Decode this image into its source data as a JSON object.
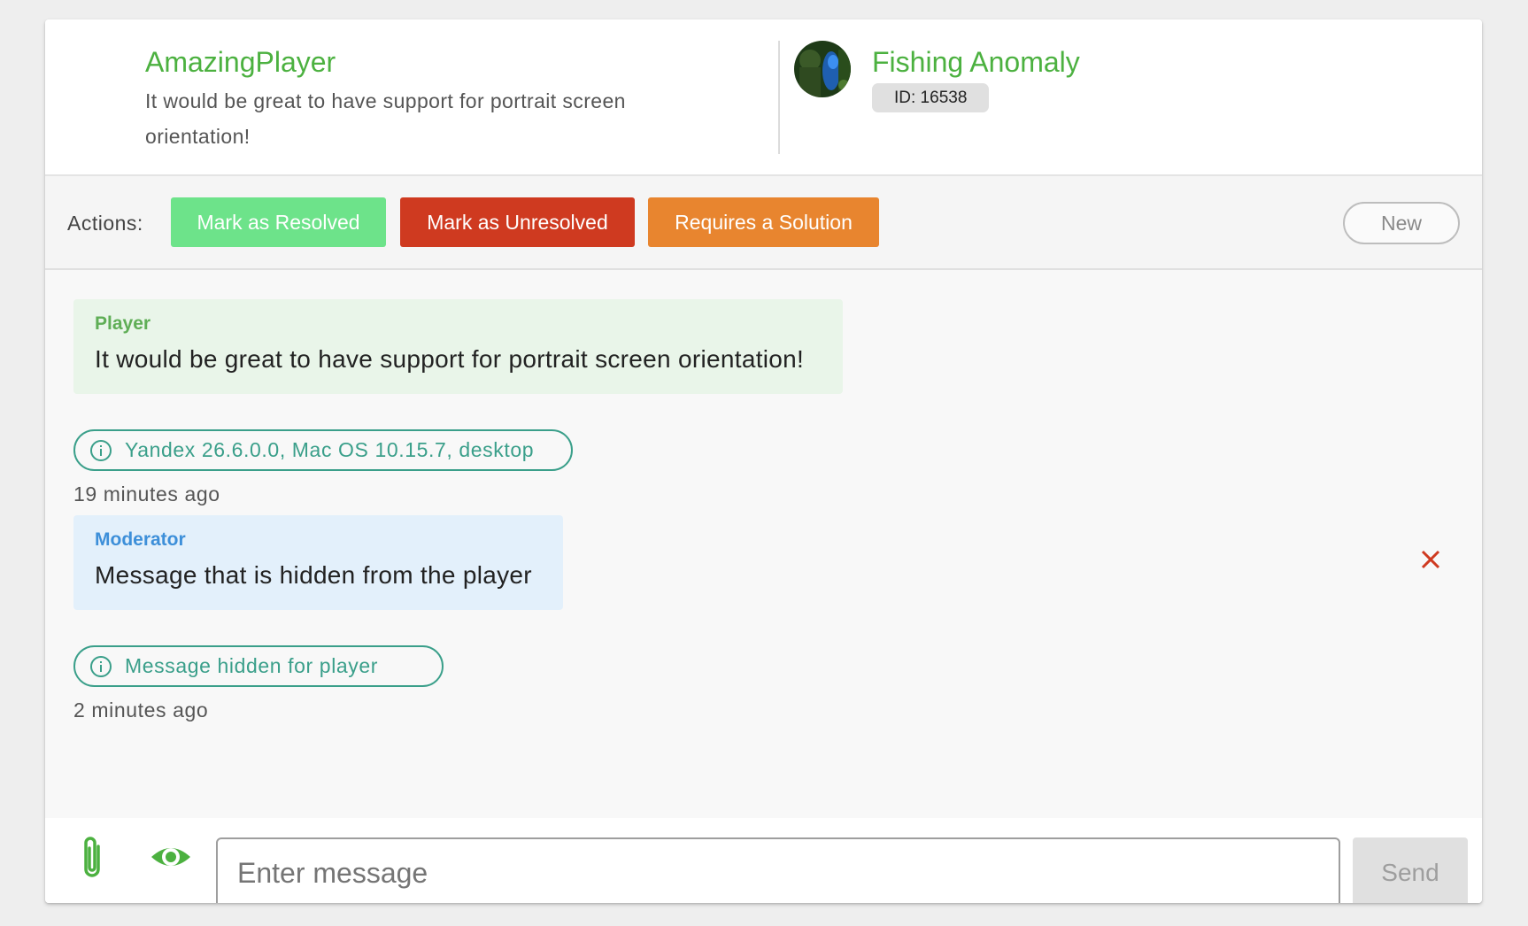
{
  "header": {
    "player_name": "AmazingPlayer",
    "subject": "It would be great to have support for portrait screen orientation!",
    "game_title": "Fishing Anomaly",
    "game_id": "ID: 16538",
    "avatar_icon": "game-avatar"
  },
  "actions": {
    "label": "Actions:",
    "resolved_label": "Mark as Resolved",
    "unresolved_label": "Mark as Unresolved",
    "solution_label": "Requires a Solution",
    "status": "New"
  },
  "messages": [
    {
      "author": "Player",
      "text": "It would be great to have support for portrait screen orientation!",
      "info": "Yandex 26.6.0.0, Mac OS 10.15.7, desktop",
      "time": "19 minutes ago"
    },
    {
      "author": "Moderator",
      "text": "Message that is hidden from the player",
      "info": "Message hidden for player",
      "time": "2 minutes ago"
    }
  ],
  "composer": {
    "placeholder": "Enter message",
    "send_label": "Send",
    "attach_icon": "paperclip-icon",
    "visibility_icon": "eye-icon"
  },
  "colors": {
    "accent_green": "#4cb140",
    "resolved": "#6de38a",
    "unresolved": "#cf3a20",
    "solution": "#e8852f",
    "info_teal": "#3a9f8a",
    "player_bubble": "#e9f5e9",
    "moderator_bubble": "#e3f0fb"
  }
}
